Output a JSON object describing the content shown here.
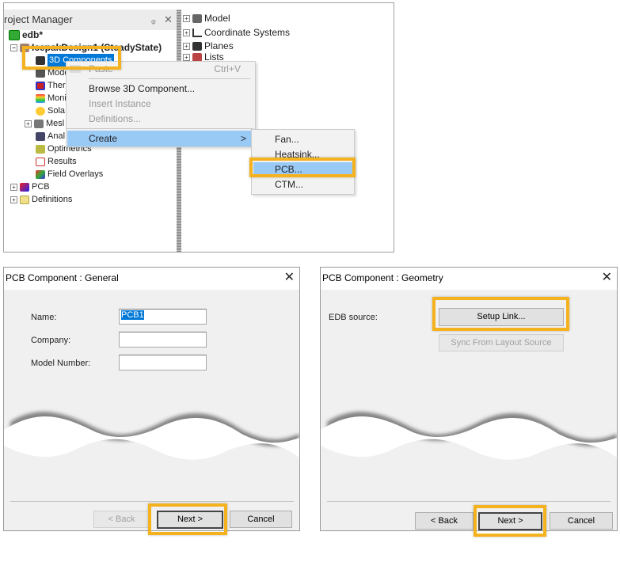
{
  "project_manager": {
    "title": "roject Manager",
    "pin_icon": "pin-icon",
    "close_icon": "close-icon",
    "tree": [
      {
        "label": "edb*",
        "icon": "project-icon"
      },
      {
        "label": "IcepakDesign1 (SteadyState)",
        "icon": "design-icon"
      },
      {
        "label": "3D Components",
        "icon": "3d-components-icon",
        "selected": true
      },
      {
        "label": "Mode",
        "icon": "model-icon"
      },
      {
        "label": "Ther",
        "icon": "thermal-icon"
      },
      {
        "label": "Moni",
        "icon": "monitor-icon"
      },
      {
        "label": "Sola",
        "icon": "solar-icon"
      },
      {
        "label": "Mesl",
        "icon": "mesh-icon"
      },
      {
        "label": "Anal",
        "icon": "analysis-icon"
      },
      {
        "label": "Optimetrics",
        "icon": "optimetrics-icon"
      },
      {
        "label": "Results",
        "icon": "results-icon"
      },
      {
        "label": "Field Overlays",
        "icon": "field-overlays-icon"
      },
      {
        "label": "PCB",
        "icon": "pcb-icon"
      },
      {
        "label": "Definitions",
        "icon": "folder-icon"
      }
    ]
  },
  "model_tree": [
    {
      "label": "Model"
    },
    {
      "label": "Coordinate Systems"
    },
    {
      "label": "Planes"
    },
    {
      "label": "Lists"
    }
  ],
  "context_menu": {
    "paste": {
      "label": "Paste",
      "shortcut": "Ctrl+V"
    },
    "items": [
      {
        "label": "Browse 3D Component...",
        "enabled": true
      },
      {
        "label": "Insert Instance",
        "enabled": false
      },
      {
        "label": "Definitions...",
        "enabled": false
      }
    ],
    "create": {
      "label": "Create",
      "arrow": ">"
    },
    "submenu": [
      {
        "label": "Fan..."
      },
      {
        "label": "Heatsink..."
      },
      {
        "label": "PCB...",
        "highlighted": true
      },
      {
        "label": "CTM..."
      }
    ]
  },
  "dialog_general": {
    "title": "PCB Component : General",
    "fields": [
      {
        "label": "Name:",
        "value": "PCB1"
      },
      {
        "label": "Company:",
        "value": ""
      },
      {
        "label": "Model Number:",
        "value": ""
      }
    ],
    "back": "< Back",
    "next": "Next >",
    "cancel": "Cancel"
  },
  "dialog_geometry": {
    "title": "PCB Component : Geometry",
    "edb_label": "EDB source:",
    "setup_link": "Setup Link...",
    "sync": "Sync From Layout Source",
    "back": "< Back",
    "next": "Next >",
    "cancel": "Cancel"
  },
  "colors": {
    "highlight": "#f5b21f",
    "menu_selection": "#99c9f5",
    "tree_selection": "#0078d7"
  }
}
